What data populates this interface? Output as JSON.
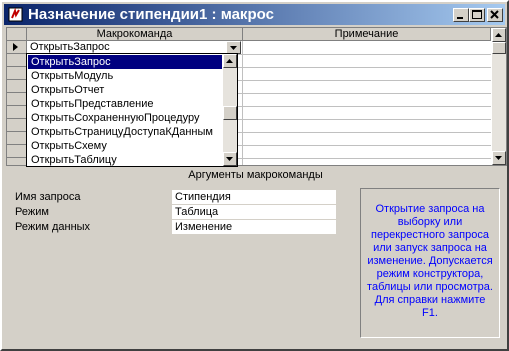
{
  "window": {
    "title": "Назначение стипендии1 : макрос"
  },
  "grid": {
    "columns": [
      "Макрокоманда",
      "Примечание"
    ],
    "current_row": {
      "action": "ОткрытьЗапрос",
      "note": ""
    }
  },
  "dropdown": {
    "items": [
      "ОткрытьЗапрос",
      "ОткрытьМодуль",
      "ОткрытьОтчет",
      "ОткрытьПредставление",
      "ОткрытьСохраненнуюПроцедуру",
      "ОткрытьСтраницуДоступаКДанным",
      "ОткрытьСхему",
      "ОткрытьТаблицу"
    ],
    "selected_index": 0
  },
  "arguments": {
    "header": "Аргументы макрокоманды",
    "fields": [
      {
        "label": "Имя запроса",
        "value": "Стипендия"
      },
      {
        "label": "Режим",
        "value": "Таблица"
      },
      {
        "label": "Режим данных",
        "value": "Изменение"
      }
    ],
    "help_text": "Открытие запроса на выборку или перекрестного запроса или запуск запроса на изменение. Допускается режим конструктора, таблицы или просмотра. Для справки нажмите F1."
  },
  "colors": {
    "title_gradient_start": "#0a246a",
    "title_gradient_end": "#a6caf0",
    "selection": "#000080",
    "help_text": "#0000ff"
  },
  "icons": [
    "macro-icon",
    "minimize-icon",
    "maximize-icon",
    "close-icon",
    "row-pointer-icon",
    "dropdown-arrow-icon",
    "scroll-up-icon",
    "scroll-down-icon"
  ]
}
